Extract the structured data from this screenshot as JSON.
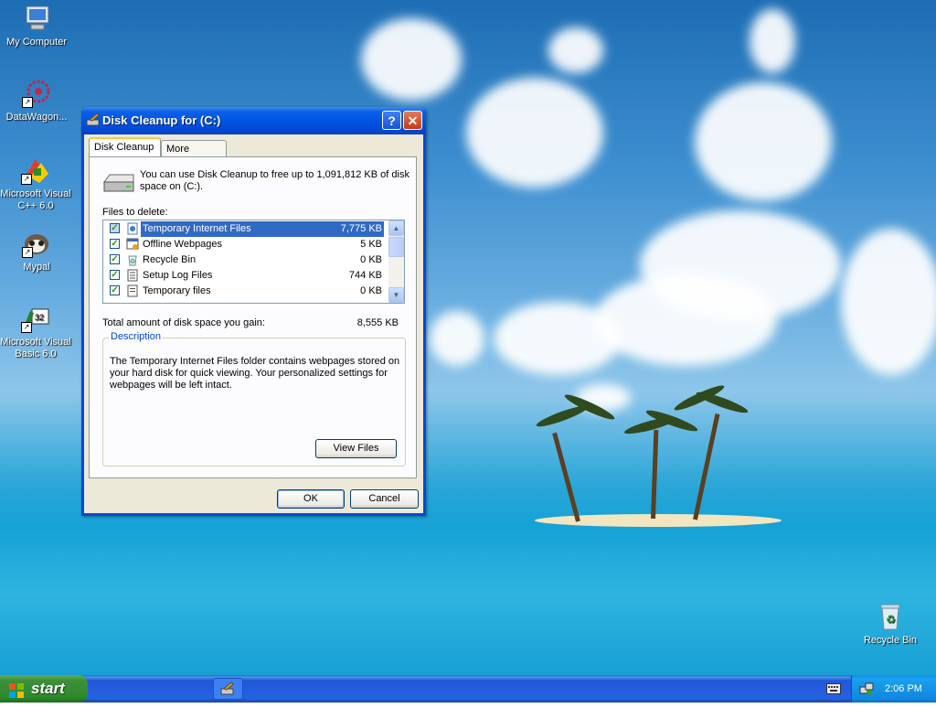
{
  "desktop": {
    "icons": [
      {
        "label": "My Computer",
        "icon": "my-computer-icon"
      },
      {
        "label": "DataWagon...",
        "icon": "datawagon-icon"
      },
      {
        "label": "Microsoft Visual C++ 6.0",
        "icon": "visual-cpp-icon"
      },
      {
        "label": "Mypal",
        "icon": "mypal-icon"
      },
      {
        "label": "Microsoft Visual Basic 6.0",
        "icon": "visual-basic-icon"
      },
      {
        "label": "Recycle Bin",
        "icon": "recycle-bin-icon"
      }
    ]
  },
  "window": {
    "title": "Disk Cleanup for  (C:)",
    "help_label": "?",
    "close_label": "✕",
    "tabs": [
      {
        "label": "Disk Cleanup",
        "active": true
      },
      {
        "label": "More Options",
        "active": false
      }
    ],
    "intro": "You can use Disk Cleanup to free up to 1,091,812 KB of disk space on  (C:).",
    "files_label": "Files to delete:",
    "files": [
      {
        "name": "Temporary Internet Files",
        "size": "7,775 KB",
        "checked": true,
        "selected": true,
        "icon": "internet-files-icon"
      },
      {
        "name": "Offline Webpages",
        "size": "5 KB",
        "checked": true,
        "selected": false,
        "icon": "offline-webpages-icon"
      },
      {
        "name": "Recycle Bin",
        "size": "0 KB",
        "checked": true,
        "selected": false,
        "icon": "recycle-bin-icon"
      },
      {
        "name": "Setup Log Files",
        "size": "744 KB",
        "checked": true,
        "selected": false,
        "icon": "log-file-icon"
      },
      {
        "name": "Temporary files",
        "size": "0 KB",
        "checked": true,
        "selected": false,
        "icon": "temp-file-icon"
      }
    ],
    "total_label": "Total amount of disk space you gain:",
    "total_value": "8,555 KB",
    "description_legend": "Description",
    "description_text": "The Temporary Internet Files folder contains webpages stored on your hard disk for quick viewing. Your personalized settings for webpages will be left intact.",
    "view_files_label": "View Files",
    "ok_label": "OK",
    "cancel_label": "Cancel"
  },
  "taskbar": {
    "start_label": "start",
    "clock": "2:06 PM"
  },
  "colors": {
    "titlebar": "#0054e3",
    "selection": "#316ac5",
    "start_green": "#3f8f3b",
    "tray_blue": "#1290e9",
    "legend_blue": "#0046d5"
  }
}
